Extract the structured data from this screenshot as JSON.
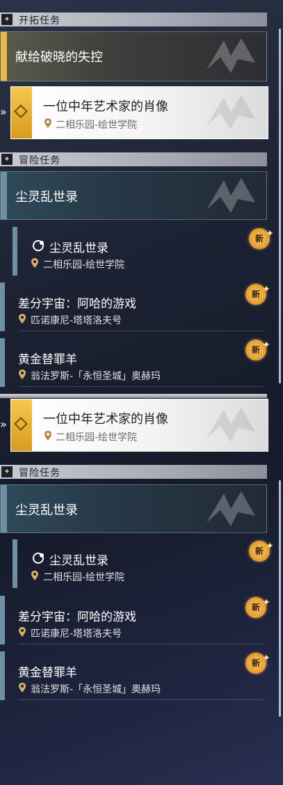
{
  "sections": {
    "trailblaze_label": "开拓任务",
    "adventure_label": "冒险任务"
  },
  "trailblaze": {
    "category_title": "献给破晓的失控"
  },
  "selected_quest": {
    "name": "一位中年艺术家的肖像",
    "location": "二相乐园-绘世学院"
  },
  "adventure": {
    "category_title": "尘灵乱世录",
    "items": [
      {
        "name": "尘灵乱世录",
        "location": "二相乐园-绘世学院",
        "badge": "新"
      },
      {
        "name": "差分宇宙：阿哈的游戏",
        "location": "匹诺康尼-塔塔洛夫号",
        "badge": "新"
      },
      {
        "name": "黄金替罪羊",
        "location": "翁法罗斯-「永恒圣城」奥赫玛",
        "badge": "新"
      }
    ]
  },
  "colors": {
    "gold_accent": "#e9b949",
    "teal_accent": "#6e8fa4",
    "badge": "#e59a2d"
  },
  "icons": {
    "section": "diamond-icon",
    "location": "map-pin-icon",
    "new": "new-badge-icon",
    "selected": "chevron-right-icon"
  }
}
